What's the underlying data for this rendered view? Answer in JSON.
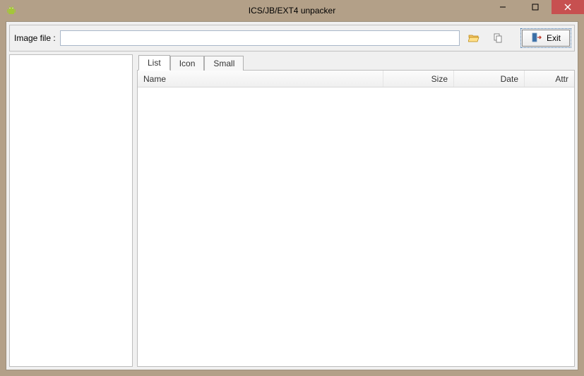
{
  "window": {
    "title": "ICS/JB/EXT4 unpacker"
  },
  "toolbar": {
    "image_file_label": "Image file :",
    "image_file_value": "",
    "exit_label": "Exit"
  },
  "tabs": [
    {
      "label": "List",
      "active": true
    },
    {
      "label": "Icon",
      "active": false
    },
    {
      "label": "Small",
      "active": false
    }
  ],
  "columns": {
    "name": "Name",
    "size": "Size",
    "date": "Date",
    "attr": "Attr"
  },
  "icons": {
    "app": "android-icon",
    "open": "folder-open-icon",
    "copy": "copy-icon",
    "exit": "exit-door-icon",
    "minimize": "minimize-icon",
    "maximize": "maximize-icon",
    "close": "close-icon"
  }
}
